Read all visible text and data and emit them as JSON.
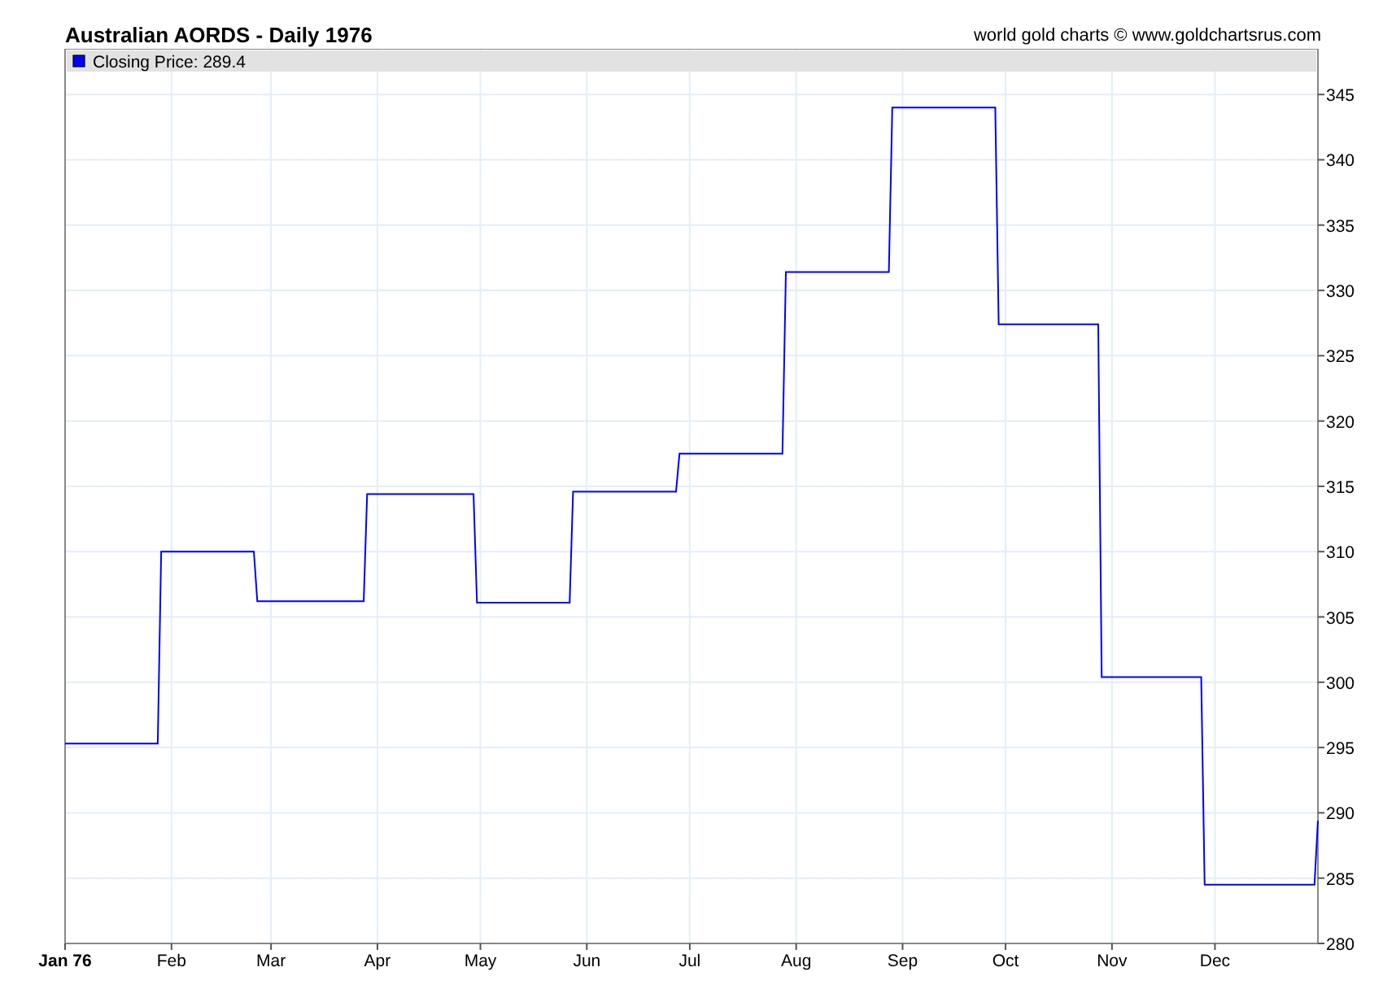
{
  "header": {
    "title": "Australian AORDS - Daily 1976",
    "credit": "world gold charts © www.goldchartsrus.com"
  },
  "chart": {
    "legend": "Closing Price: 289.4",
    "chart_data": {
      "type": "line",
      "ylim": [
        280,
        348.5
      ],
      "grid": true,
      "categories": [
        "Jan 76",
        null,
        null,
        null,
        null,
        null,
        null,
        null,
        null,
        null,
        null,
        null,
        null,
        null,
        null,
        null,
        null,
        null,
        null,
        null,
        null,
        null,
        null,
        null,
        null,
        null,
        null,
        null,
        null,
        null,
        null,
        "Feb",
        null,
        null,
        null,
        null,
        null,
        null,
        null,
        null,
        null,
        null,
        null,
        null,
        null,
        null,
        null,
        null,
        null,
        null,
        null,
        null,
        null,
        null,
        null,
        null,
        null,
        null,
        null,
        null,
        "Mar",
        null,
        null,
        null,
        null,
        null,
        null,
        null,
        null,
        null,
        null,
        null,
        null,
        null,
        null,
        null,
        null,
        null,
        null,
        null,
        null,
        null,
        null,
        null,
        null,
        null,
        null,
        null,
        null,
        null,
        null,
        "Apr",
        null,
        null,
        null,
        null,
        null,
        null,
        null,
        null,
        null,
        null,
        null,
        null,
        null,
        null,
        null,
        null,
        null,
        null,
        null,
        null,
        null,
        null,
        null,
        null,
        null,
        null,
        null,
        null,
        null,
        "May",
        null,
        null,
        null,
        null,
        null,
        null,
        null,
        null,
        null,
        null,
        null,
        null,
        null,
        null,
        null,
        null,
        null,
        null,
        null,
        null,
        null,
        null,
        null,
        null,
        null,
        null,
        null,
        null,
        null,
        null,
        "Jun",
        null,
        null,
        null,
        null,
        null,
        null,
        null,
        null,
        null,
        null,
        null,
        null,
        null,
        null,
        null,
        null,
        null,
        null,
        null,
        null,
        null,
        null,
        null,
        null,
        null,
        null,
        null,
        null,
        null,
        "Jul",
        null,
        null,
        null,
        null,
        null,
        null,
        null,
        null,
        null,
        null,
        null,
        null,
        null,
        null,
        null,
        null,
        null,
        null,
        null,
        null,
        null,
        null,
        null,
        null,
        null,
        null,
        null,
        null,
        null,
        null,
        "Aug",
        null,
        null,
        null,
        null,
        null,
        null,
        null,
        null,
        null,
        null,
        null,
        null,
        null,
        null,
        null,
        null,
        null,
        null,
        null,
        null,
        null,
        null,
        null,
        null,
        null,
        null,
        null,
        null,
        null,
        null,
        "Sep",
        null,
        null,
        null,
        null,
        null,
        null,
        null,
        null,
        null,
        null,
        null,
        null,
        null,
        null,
        null,
        null,
        null,
        null,
        null,
        null,
        null,
        null,
        null,
        null,
        null,
        null,
        null,
        null,
        null,
        "Oct",
        null,
        null,
        null,
        null,
        null,
        null,
        null,
        null,
        null,
        null,
        null,
        null,
        null,
        null,
        null,
        null,
        null,
        null,
        null,
        null,
        null,
        null,
        null,
        null,
        null,
        null,
        null,
        null,
        null,
        null,
        "Nov",
        null,
        null,
        null,
        null,
        null,
        null,
        null,
        null,
        null,
        null,
        null,
        null,
        null,
        null,
        null,
        null,
        null,
        null,
        null,
        null,
        null,
        null,
        null,
        null,
        null,
        null,
        null,
        null,
        null,
        "Dec",
        null,
        null,
        null,
        null,
        null,
        null,
        null,
        null,
        null,
        null,
        null,
        null,
        null,
        null,
        null,
        null,
        null,
        null,
        null,
        null,
        null,
        null,
        null,
        null,
        null,
        null,
        null,
        null,
        null,
        null
      ],
      "yticks": [
        280,
        285,
        290,
        295,
        300,
        305,
        310,
        315,
        320,
        325,
        330,
        335,
        340,
        345
      ],
      "series": [
        {
          "color": "#0000ff",
          "values": [
            295.3,
            295.3,
            295.3,
            295.3,
            295.3,
            295.3,
            295.3,
            295.3,
            295.3,
            295.3,
            295.3,
            295.3,
            295.3,
            295.3,
            295.3,
            295.3,
            295.3,
            295.3,
            295.3,
            295.3,
            295.3,
            295.3,
            295.3,
            295.3,
            295.3,
            295.3,
            295.3,
            295.3,
            310.0,
            310.0,
            310.0,
            310.0,
            310.0,
            310.0,
            310.0,
            310.0,
            310.0,
            310.0,
            310.0,
            310.0,
            310.0,
            310.0,
            310.0,
            310.0,
            310.0,
            310.0,
            310.0,
            310.0,
            310.0,
            310.0,
            310.0,
            310.0,
            310.0,
            310.0,
            310.0,
            310.0,
            306.2,
            306.2,
            306.2,
            306.2,
            306.2,
            306.2,
            306.2,
            306.2,
            306.2,
            306.2,
            306.2,
            306.2,
            306.2,
            306.2,
            306.2,
            306.2,
            306.2,
            306.2,
            306.2,
            306.2,
            306.2,
            306.2,
            306.2,
            306.2,
            306.2,
            306.2,
            306.2,
            306.2,
            306.2,
            306.2,
            306.2,
            306.2,
            314.4,
            314.4,
            314.4,
            314.4,
            314.4,
            314.4,
            314.4,
            314.4,
            314.4,
            314.4,
            314.4,
            314.4,
            314.4,
            314.4,
            314.4,
            314.4,
            314.4,
            314.4,
            314.4,
            314.4,
            314.4,
            314.4,
            314.4,
            314.4,
            314.4,
            314.4,
            314.4,
            314.4,
            314.4,
            314.4,
            314.4,
            314.4,
            306.1,
            306.1,
            306.1,
            306.1,
            306.1,
            306.1,
            306.1,
            306.1,
            306.1,
            306.1,
            306.1,
            306.1,
            306.1,
            306.1,
            306.1,
            306.1,
            306.1,
            306.1,
            306.1,
            306.1,
            306.1,
            306.1,
            306.1,
            306.1,
            306.1,
            306.1,
            306.1,
            306.1,
            314.6,
            314.6,
            314.6,
            314.6,
            314.6,
            314.6,
            314.6,
            314.6,
            314.6,
            314.6,
            314.6,
            314.6,
            314.6,
            314.6,
            314.6,
            314.6,
            314.6,
            314.6,
            314.6,
            314.6,
            314.6,
            314.6,
            314.6,
            314.6,
            314.6,
            314.6,
            314.6,
            314.6,
            314.6,
            314.6,
            314.6,
            317.5,
            317.5,
            317.5,
            317.5,
            317.5,
            317.5,
            317.5,
            317.5,
            317.5,
            317.5,
            317.5,
            317.5,
            317.5,
            317.5,
            317.5,
            317.5,
            317.5,
            317.5,
            317.5,
            317.5,
            317.5,
            317.5,
            317.5,
            317.5,
            317.5,
            317.5,
            317.5,
            317.5,
            317.5,
            317.5,
            317.5,
            331.4,
            331.4,
            331.4,
            331.4,
            331.4,
            331.4,
            331.4,
            331.4,
            331.4,
            331.4,
            331.4,
            331.4,
            331.4,
            331.4,
            331.4,
            331.4,
            331.4,
            331.4,
            331.4,
            331.4,
            331.4,
            331.4,
            331.4,
            331.4,
            331.4,
            331.4,
            331.4,
            331.4,
            331.4,
            331.4,
            331.4,
            344.0,
            344.0,
            344.0,
            344.0,
            344.0,
            344.0,
            344.0,
            344.0,
            344.0,
            344.0,
            344.0,
            344.0,
            344.0,
            344.0,
            344.0,
            344.0,
            344.0,
            344.0,
            344.0,
            344.0,
            344.0,
            344.0,
            344.0,
            344.0,
            344.0,
            344.0,
            344.0,
            344.0,
            344.0,
            344.0,
            344.0,
            327.4,
            327.4,
            327.4,
            327.4,
            327.4,
            327.4,
            327.4,
            327.4,
            327.4,
            327.4,
            327.4,
            327.4,
            327.4,
            327.4,
            327.4,
            327.4,
            327.4,
            327.4,
            327.4,
            327.4,
            327.4,
            327.4,
            327.4,
            327.4,
            327.4,
            327.4,
            327.4,
            327.4,
            327.4,
            327.4,
            300.4,
            300.4,
            300.4,
            300.4,
            300.4,
            300.4,
            300.4,
            300.4,
            300.4,
            300.4,
            300.4,
            300.4,
            300.4,
            300.4,
            300.4,
            300.4,
            300.4,
            300.4,
            300.4,
            300.4,
            300.4,
            300.4,
            300.4,
            300.4,
            300.4,
            300.4,
            300.4,
            300.4,
            300.4,
            300.4,
            284.5,
            284.5,
            284.5,
            284.5,
            284.5,
            284.5,
            284.5,
            284.5,
            284.5,
            284.5,
            284.5,
            284.5,
            284.5,
            284.5,
            284.5,
            284.5,
            284.5,
            284.5,
            284.5,
            284.5,
            284.5,
            284.5,
            284.5,
            284.5,
            284.5,
            284.5,
            284.5,
            284.5,
            284.5,
            284.5,
            284.5,
            284.5,
            284.5,
            289.4
          ]
        }
      ]
    }
  }
}
